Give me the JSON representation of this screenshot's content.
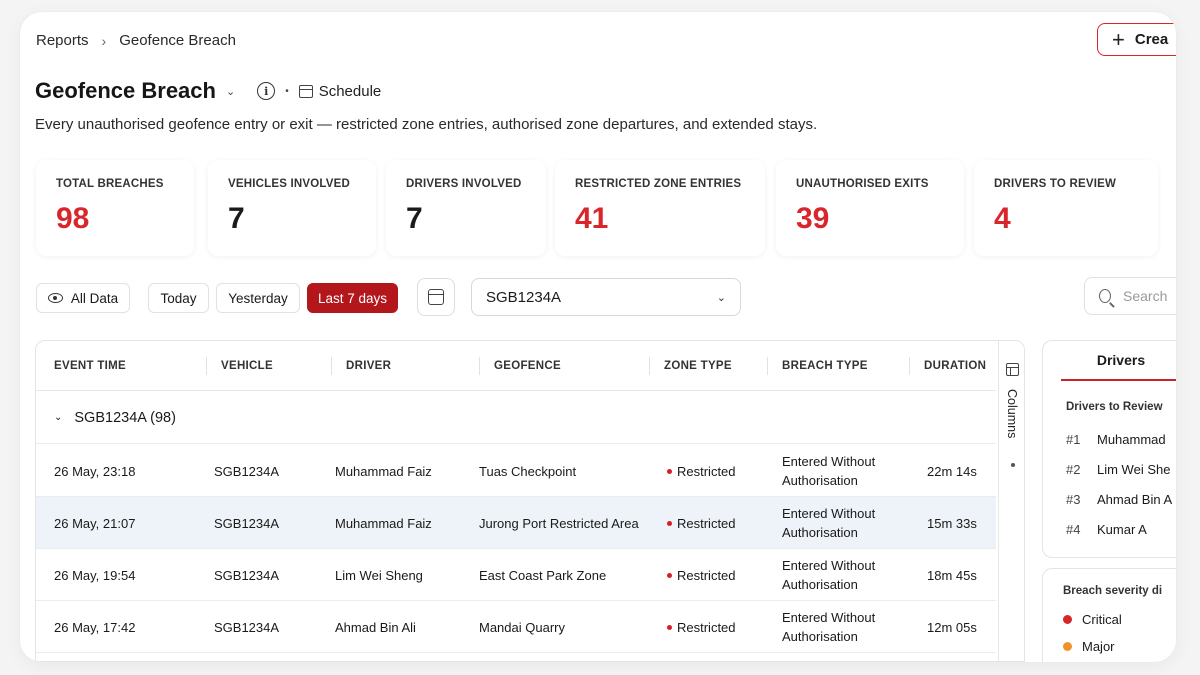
{
  "breadcrumb": {
    "root": "Reports",
    "current": "Geofence Breach"
  },
  "header": {
    "create_label": "Crea",
    "title": "Geofence Breach",
    "schedule_label": "Schedule",
    "description": "Every unauthorised geofence entry or exit — restricted zone entries, authorised zone departures, and extended stays."
  },
  "stats": [
    {
      "label": "TOTAL BREACHES",
      "value": "98",
      "color": "#d8262b"
    },
    {
      "label": "VEHICLES INVOLVED",
      "value": "7",
      "color": "#1a1a1a"
    },
    {
      "label": "DRIVERS INVOLVED",
      "value": "7",
      "color": "#1a1a1a"
    },
    {
      "label": "RESTRICTED ZONE ENTRIES",
      "value": "41",
      "color": "#d8262b"
    },
    {
      "label": "UNAUTHORISED EXITS",
      "value": "39",
      "color": "#d8262b"
    },
    {
      "label": "DRIVERS TO REVIEW",
      "value": "4",
      "color": "#d8262b"
    }
  ],
  "filters": {
    "all_data": "All Data",
    "today": "Today",
    "yesterday": "Yesterday",
    "last7": "Last 7 days",
    "vehicle_select": "SGB1234A",
    "search_placeholder": "Search"
  },
  "colors": {
    "accent": "#b3171c",
    "danger": "#d8262b",
    "highlight_row": "#eef3fa"
  },
  "table": {
    "headers": [
      "EVENT TIME",
      "VEHICLE",
      "DRIVER",
      "GEOFENCE",
      "ZONE TYPE",
      "BREACH TYPE",
      "DURATION"
    ],
    "group_label": "SGB1234A (98)",
    "columns_label": "Columns",
    "rows": [
      {
        "time": "26 May, 23:18",
        "vehicle": "SGB1234A",
        "driver": "Muhammad Faiz",
        "geofence": "Tuas Checkpoint",
        "zone": "Restricted",
        "breach": "Entered Without Authorisation",
        "duration": "22m 14s"
      },
      {
        "time": "26 May, 21:07",
        "vehicle": "SGB1234A",
        "driver": "Muhammad Faiz",
        "geofence": "Jurong Port Restricted Area",
        "zone": "Restricted",
        "breach": "Entered Without Authorisation",
        "duration": "15m 33s"
      },
      {
        "time": "26 May, 19:54",
        "vehicle": "SGB1234A",
        "driver": "Lim Wei Sheng",
        "geofence": "East Coast Park Zone",
        "zone": "Restricted",
        "breach": "Entered Without Authorisation",
        "duration": "18m 45s"
      },
      {
        "time": "26 May, 17:42",
        "vehicle": "SGB1234A",
        "driver": "Ahmad Bin Ali",
        "geofence": "Mandai Quarry",
        "zone": "Restricted",
        "breach": "Entered Without Authorisation",
        "duration": "12m 05s"
      }
    ]
  },
  "side_panel": {
    "tab": "Drivers",
    "heading": "Drivers to Review",
    "drivers": [
      {
        "rank": "#1",
        "name": "Muhammad"
      },
      {
        "rank": "#2",
        "name": "Lim Wei She"
      },
      {
        "rank": "#3",
        "name": "Ahmad Bin A"
      },
      {
        "rank": "#4",
        "name": "Kumar A"
      }
    ],
    "severity_heading": "Breach severity di",
    "severity": [
      {
        "label": "Critical",
        "color": "#d8262b"
      },
      {
        "label": "Major",
        "color": "#f0922b"
      }
    ]
  }
}
